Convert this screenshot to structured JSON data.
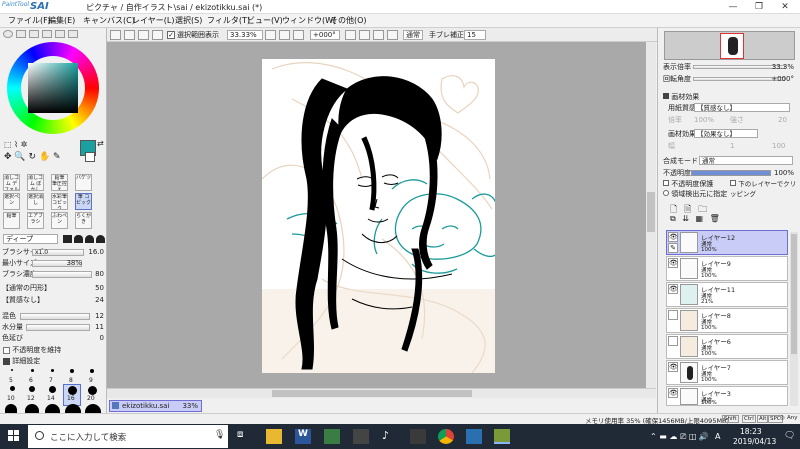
{
  "window": {
    "logo_small": "PaintTool",
    "logo_main": "SAI",
    "title": "ピクチャ / 自作イラスト\\sai / ekizotikku.sai (*)",
    "buttons": [
      "—",
      "❐",
      "✕"
    ]
  },
  "menu": [
    "ファイル(F)",
    "編集(E)",
    "キャンバス(C)",
    "レイヤー(L)",
    "選択(S)",
    "フィルタ(T)",
    "ビュー(V)",
    "ウィンドウ(W)",
    "その他(O)"
  ],
  "toolbar": {
    "selection_checkbox": "選択範囲表示",
    "zoom": "33.33%",
    "angle": "+000°",
    "mode": "通常",
    "stabilizer_label": "手ブレ補正",
    "stabilizer_value": "15"
  },
  "colors": {
    "current": "#1aa0a0",
    "accent_layer": "#c9ccf6"
  },
  "tools": {
    "row1": [
      "消しゴム デフォルト",
      "消しゴム ぼかし",
      "鉛筆 筆圧控え",
      "バケツ"
    ],
    "row2": [
      "選択ペン",
      "選択消し",
      "水彩筆 コピック",
      "筆 コピック"
    ],
    "row3": [
      "鉛筆",
      "エアブラシ",
      "ふわペン",
      "らくがき"
    ]
  },
  "brush": {
    "shape": "ディープ",
    "size_label": "ブラシサイズ",
    "size_mult": "x1.0",
    "size_value": "16.0",
    "min_size_label": "最小サイズ",
    "min_size_value": "38%",
    "density_label": "ブラシ濃度",
    "density_value": "80",
    "edge_label": "【通常の円形】",
    "edge_value": "50",
    "texture_label": "【質感なし】",
    "texture_value": "24",
    "blend_label": "混色",
    "blend_value": "12",
    "water_label": "水分量",
    "water_value": "11",
    "stretch_label": "色延び",
    "stretch_value": "0",
    "keep_opacity": "不透明度を維持",
    "detail_label": "詳細設定"
  },
  "dot_sizes_row1": [
    "5",
    "6",
    "7",
    "8",
    "9"
  ],
  "dot_sizes_row2": [
    "10",
    "12",
    "14",
    "16",
    "20"
  ],
  "document_tab": {
    "name": "ekizotikku.sai",
    "zoom": "33%"
  },
  "navigator": {
    "zoom_label": "表示倍率",
    "zoom_value": "33.3%",
    "rotate_label": "回転角度",
    "rotate_value": "+000°"
  },
  "paper": {
    "section": "画材効果",
    "texture_label": "用紙質感",
    "texture_value": "【質感なし】",
    "scale_label": "倍率",
    "scale_value": "100%",
    "strength_label": "強さ",
    "strength_value": "20",
    "effect_label": "画材効果",
    "effect_value": "【効果なし】",
    "width_label": "幅",
    "width_value": "1",
    "intensity_value": "100"
  },
  "layer_panel": {
    "mode_label": "合成モード",
    "mode_value": "通常",
    "opacity_label": "不透明度",
    "opacity_value": "100%",
    "protect_opacity": "不透明度保護",
    "clip": "下のレイヤーでクリッピング",
    "selection_source": "領域検出元に指定"
  },
  "layers": [
    {
      "name": "レイヤー12",
      "mode": "通常",
      "opacity": "100%",
      "selected": true
    },
    {
      "name": "レイヤー9",
      "mode": "通常",
      "opacity": "100%",
      "selected": false
    },
    {
      "name": "レイヤー11",
      "mode": "通常",
      "opacity": "21%",
      "selected": false
    },
    {
      "name": "レイヤー8",
      "mode": "通常",
      "opacity": "100%",
      "selected": false
    },
    {
      "name": "レイヤー6",
      "mode": "通常",
      "opacity": "100%",
      "selected": false
    },
    {
      "name": "レイヤー7",
      "mode": "通常",
      "opacity": "100%",
      "selected": false
    },
    {
      "name": "レイヤー3",
      "mode": "通常",
      "opacity": "100%",
      "selected": false
    }
  ],
  "status": {
    "memory": "メモリ使用率 35% (確保1456MB/上限4095MB)",
    "keys": [
      "Shift",
      "Ctrl",
      "Alt",
      "SPC",
      "◎",
      "Any"
    ]
  },
  "taskbar": {
    "search_placeholder": "ここに入力して検索",
    "time": "18:23",
    "date": "2019/04/13",
    "lang": "A"
  }
}
